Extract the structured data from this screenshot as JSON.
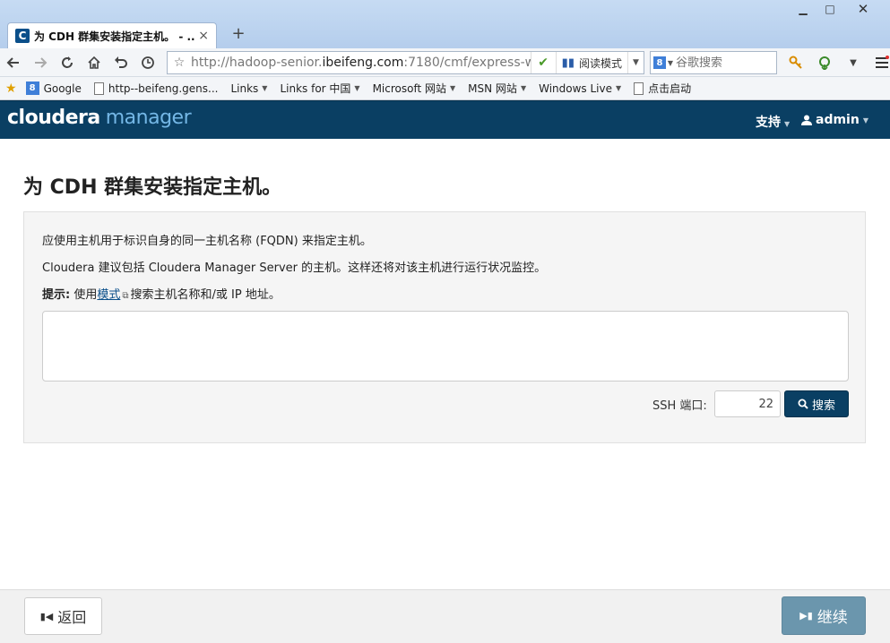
{
  "browser": {
    "tab_title": "为 CDH 群集安装指定主机。 - ...",
    "tab_favicon": "C",
    "tab_close": "×",
    "new_tab": "+",
    "window_controls": {
      "minimize": "▁",
      "maximize": "□",
      "close": "✕"
    },
    "url_prefix": "http://hadoop-senior.",
    "url_host": "ibeifeng.com",
    "url_suffix": ":7180/cmf/express-wi",
    "reader_mode_label": "阅读模式",
    "search_placeholder": "谷歌搜索",
    "search_engine_glyph": "8",
    "icons": {
      "back": "arrow-left-icon",
      "forward": "arrow-right-icon",
      "reload": "reload-icon",
      "home": "home-icon",
      "undo": "undo-icon",
      "history": "clock-icon",
      "bookmark_star": "star-icon",
      "key": "key-icon",
      "download": "download-icon",
      "menu": "menu-icon"
    }
  },
  "bookmarks": [
    {
      "label": "Google",
      "icon": "google",
      "dropdown": false
    },
    {
      "label": "http--beifeng.gens...",
      "icon": "page",
      "dropdown": false
    },
    {
      "label": "Links",
      "icon": "none",
      "dropdown": true
    },
    {
      "label": "Links for 中国",
      "icon": "none",
      "dropdown": true
    },
    {
      "label": "Microsoft 网站",
      "icon": "none",
      "dropdown": true
    },
    {
      "label": "MSN 网站",
      "icon": "none",
      "dropdown": true
    },
    {
      "label": "Windows Live",
      "icon": "none",
      "dropdown": true
    },
    {
      "label": "点击启动",
      "icon": "page",
      "dropdown": false
    }
  ],
  "header": {
    "logo_main": "cloudera",
    "logo_sub": "manager",
    "support_label": "支持",
    "user_label": "admin"
  },
  "main": {
    "title": "为 CDH 群集安装指定主机。",
    "line1": "应使用主机用于标识自身的同一主机名称 (FQDN) 来指定主机。",
    "line2": "Cloudera 建议包括 Cloudera Manager Server 的主机。这样还将对该主机进行运行状况监控。",
    "tip_label": "提示:",
    "tip_pre": " 使用",
    "tip_link": "模式",
    "tip_post": "搜索主机名称和/或 IP 地址。",
    "hosts_value": "",
    "ssh_label": "SSH 端口:",
    "ssh_port": "22",
    "search_button": "搜索"
  },
  "footer": {
    "back_button": "返回",
    "continue_button": "继续"
  },
  "colors": {
    "header_bg": "#0a3f63",
    "logo_accent": "#74b7e6",
    "continue_bg": "#6b96ad",
    "link": "#0b4f8a"
  }
}
